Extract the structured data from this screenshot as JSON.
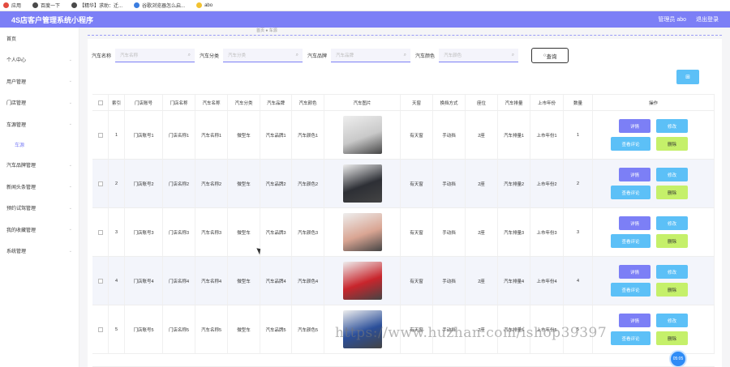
{
  "bookmarks": [
    {
      "label": "应用",
      "color": "#e34b3f"
    },
    {
      "label": "百度一下",
      "color": "#4a4a4a"
    },
    {
      "label": "【精华】求助：迁...",
      "color": "#4a4a4a"
    },
    {
      "label": "谷歌浏览器怎么启...",
      "color": "#3a7de0"
    },
    {
      "label": "abo",
      "color": "#f2c230"
    }
  ],
  "header": {
    "title": "4S店客户管理系统小程序",
    "user": "管理员 abo",
    "logout": "退出登录"
  },
  "sidebar": {
    "items": [
      {
        "label": "首页",
        "chev": false
      },
      {
        "label": "个人中心",
        "chev": true
      },
      {
        "label": "用户管理",
        "chev": true
      },
      {
        "label": "门店管理",
        "chev": true
      },
      {
        "label": "车源管理",
        "chev": true,
        "sub": "车源"
      },
      {
        "label": "汽车品牌管理",
        "chev": true
      },
      {
        "label": "新闻头条管理",
        "chev": true
      },
      {
        "label": "预约试驾管理",
        "chev": true
      },
      {
        "label": "我的收藏管理",
        "chev": true
      },
      {
        "label": "系统管理",
        "chev": true
      }
    ]
  },
  "breadcrumb": "首页 ● 车源",
  "search": {
    "fields": [
      {
        "label": "汽车名称",
        "placeholder": "汽车名称"
      },
      {
        "label": "汽车分类",
        "placeholder": "汽车分类"
      },
      {
        "label": "汽车品牌",
        "placeholder": "汽车品牌"
      },
      {
        "label": "汽车颜色",
        "placeholder": "汽车颜色"
      }
    ],
    "button": "查询"
  },
  "table": {
    "headers": [
      "",
      "索引",
      "门店账号",
      "门店名称",
      "汽车名称",
      "汽车分类",
      "汽车品牌",
      "汽车颜色",
      "汽车图片",
      "天窗",
      "换挡方式",
      "座位",
      "汽车排量",
      "上市年份",
      "数量",
      "操作"
    ],
    "rows": [
      {
        "index": "1",
        "store_account": "门店账号1",
        "store_name": "门店名称1",
        "car_name": "汽车名称1",
        "category": "微型车",
        "brand": "汽车品牌1",
        "color": "汽车颜色1",
        "sunroof": "有天窗",
        "gearbox": "手动挡",
        "seats": "2座",
        "displacement": "汽车排量1",
        "year": "上市年份1",
        "qty": "1",
        "img_color": "#c9c9c9"
      },
      {
        "index": "2",
        "store_account": "门店账号2",
        "store_name": "门店名称2",
        "car_name": "汽车名称2",
        "category": "微型车",
        "brand": "汽车品牌2",
        "color": "汽车颜色2",
        "sunroof": "有天窗",
        "gearbox": "手动挡",
        "seats": "2座",
        "displacement": "汽车排量2",
        "year": "上市年份2",
        "qty": "2",
        "img_color": "#2d2f35"
      },
      {
        "index": "3",
        "store_account": "门店账号3",
        "store_name": "门店名称3",
        "car_name": "汽车名称3",
        "category": "微型车",
        "brand": "汽车品牌3",
        "color": "汽车颜色3",
        "sunroof": "有天窗",
        "gearbox": "手动挡",
        "seats": "2座",
        "displacement": "汽车排量3",
        "year": "上市年份3",
        "qty": "3",
        "img_color": "#d9a593"
      },
      {
        "index": "4",
        "store_account": "门店账号4",
        "store_name": "门店名称4",
        "car_name": "汽车名称4",
        "category": "微型车",
        "brand": "汽车品牌4",
        "color": "汽车颜色4",
        "sunroof": "有天窗",
        "gearbox": "手动挡",
        "seats": "2座",
        "displacement": "汽车排量4",
        "year": "上市年份4",
        "qty": "4",
        "img_color": "#c8252c"
      },
      {
        "index": "5",
        "store_account": "门店账号5",
        "store_name": "门店名称5",
        "car_name": "汽车名称5",
        "category": "微型车",
        "brand": "汽车品牌5",
        "color": "汽车颜色5",
        "sunroof": "有天窗",
        "gearbox": "手动挡",
        "seats": "2座",
        "displacement": "汽车排量5",
        "year": "上市年份5",
        "qty": "5",
        "img_color": "#2b4f9a"
      }
    ],
    "actions": {
      "detail": "详情",
      "edit": "修改",
      "review": "查看评论",
      "delete": "删除"
    }
  },
  "watermark": "https://www.huzhan.com/ishop39397",
  "badge": "05:05"
}
